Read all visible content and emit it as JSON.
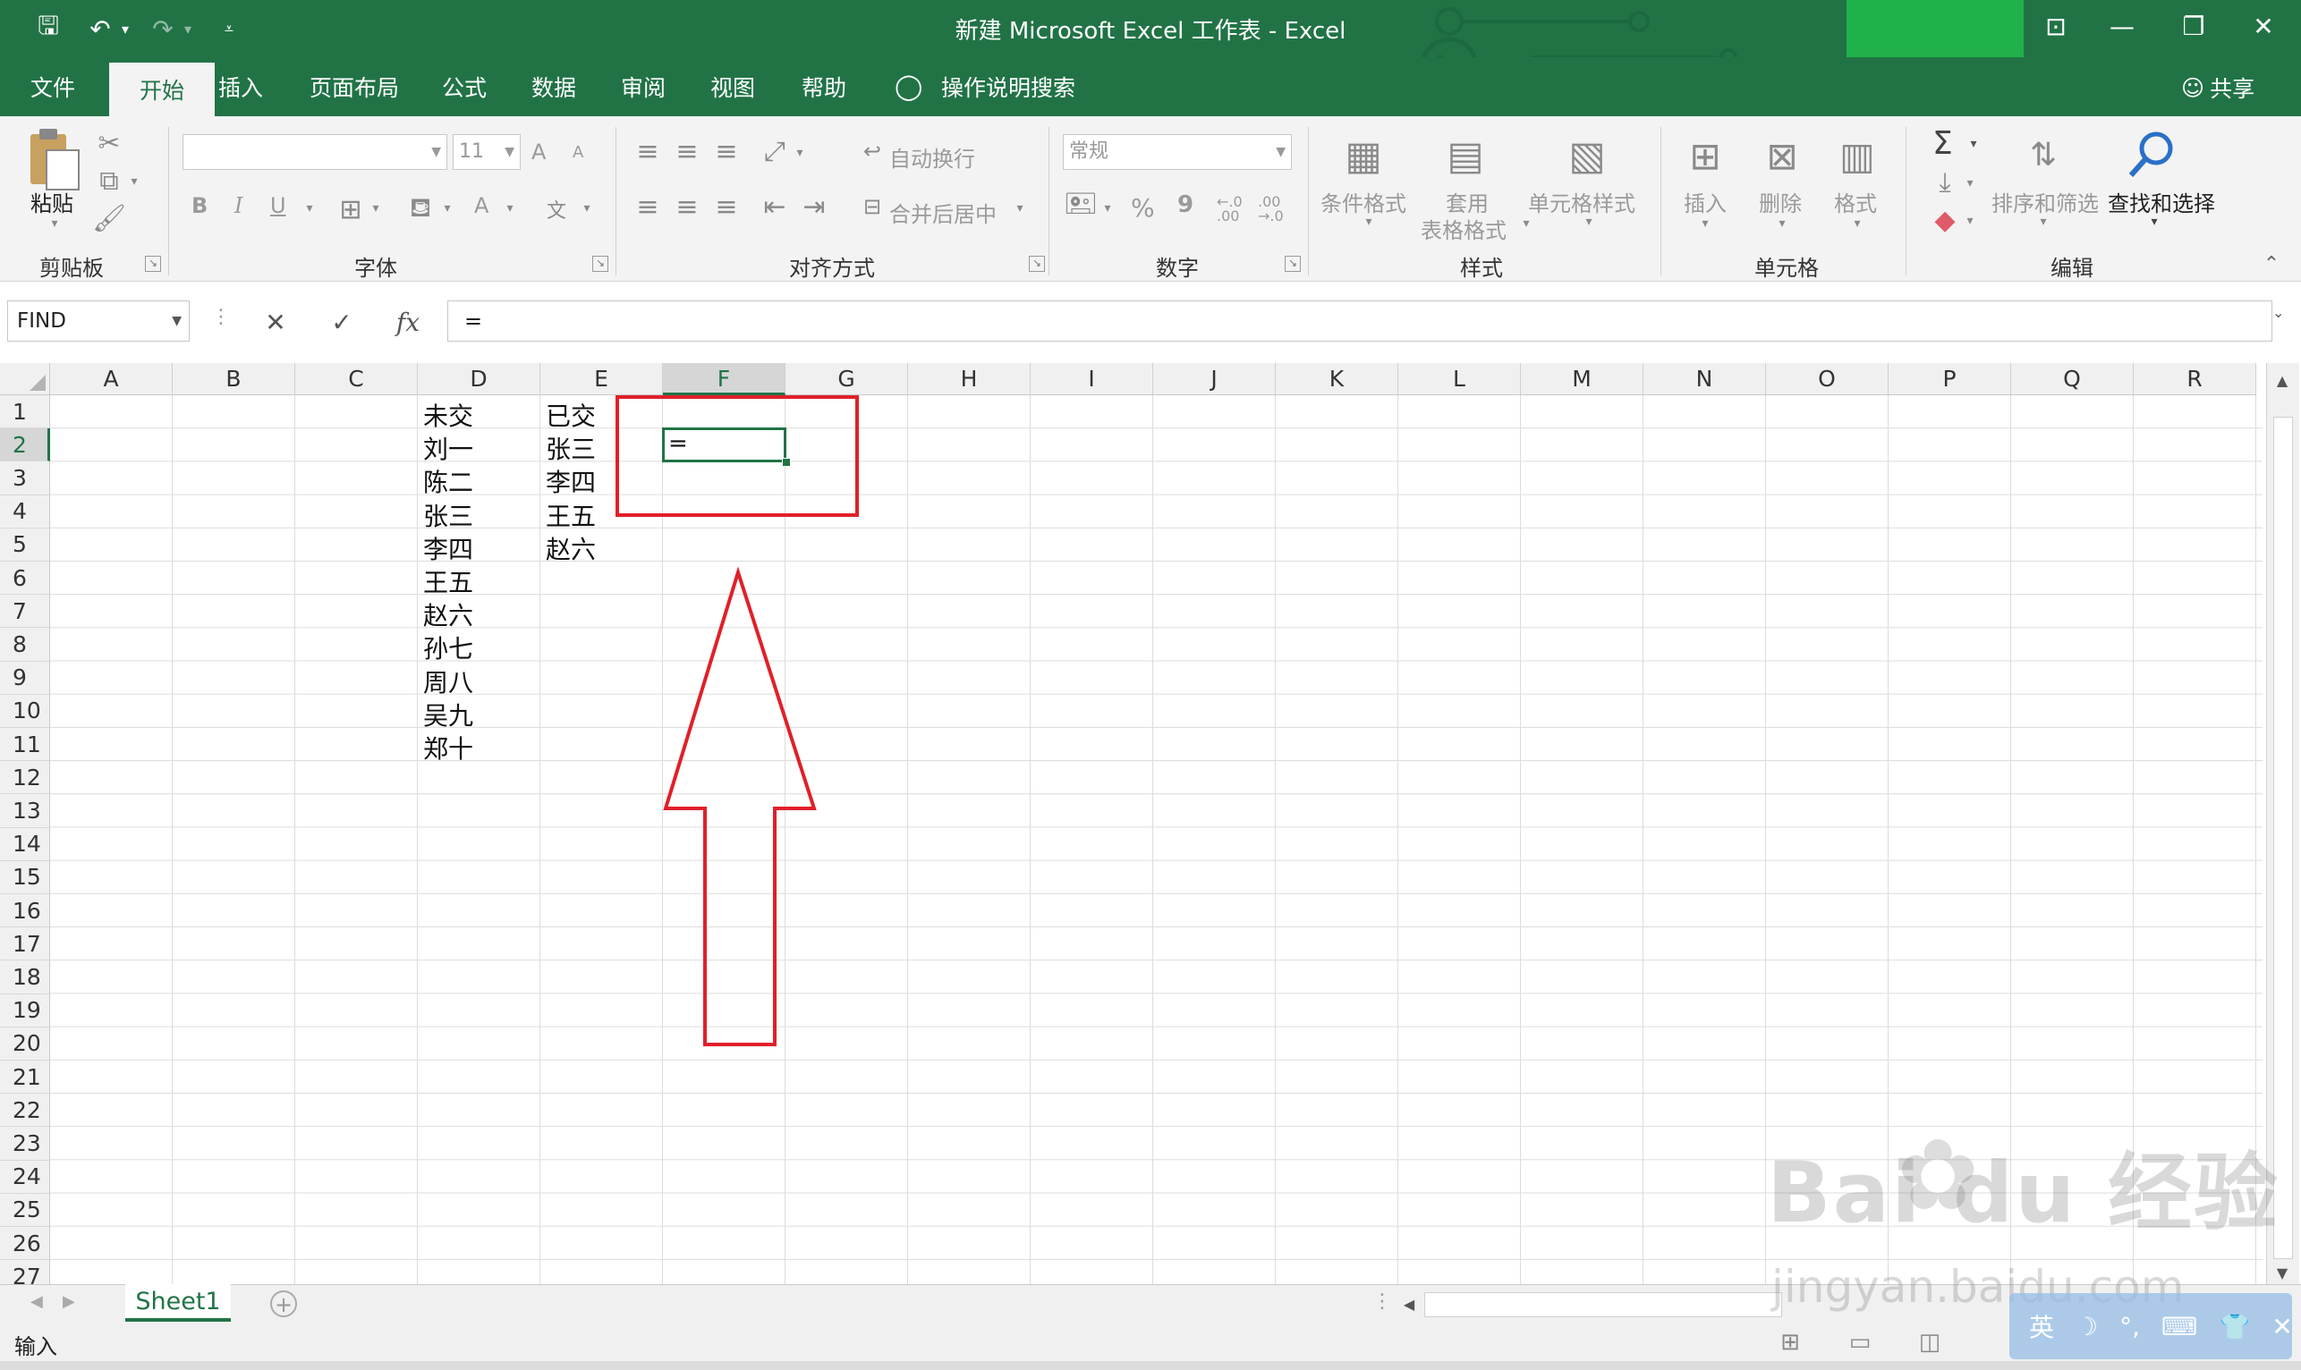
{
  "window": {
    "title": "新建 Microsoft Excel 工作表  -  Excel",
    "controls": {
      "ribbon_display": "⊡",
      "minimize": "—",
      "restore": "❐",
      "close": "✕"
    }
  },
  "qat": {
    "save": "🖫",
    "undo": "↶",
    "undo_dropdown": "▾",
    "redo": "↷",
    "redo_dropdown": "▾",
    "customize": "⩡"
  },
  "tabs": [
    {
      "label": "文件"
    },
    {
      "label": "开始"
    },
    {
      "label": "插入"
    },
    {
      "label": "页面布局"
    },
    {
      "label": "公式"
    },
    {
      "label": "数据"
    },
    {
      "label": "审阅"
    },
    {
      "label": "视图"
    },
    {
      "label": "帮助"
    }
  ],
  "tellme": "操作说明搜索",
  "share": "共享",
  "ribbon": {
    "clipboard": {
      "label": "剪贴板",
      "paste": "粘贴"
    },
    "font": {
      "label": "字体",
      "font_name": "",
      "font_size": "11",
      "bold": "B",
      "italic": "I",
      "underline": "U",
      "font_color": "A",
      "grow": "A",
      "shrink": "A"
    },
    "alignment": {
      "label": "对齐方式",
      "wrap": "自动换行",
      "merge": "合并后居中"
    },
    "number": {
      "label": "数字",
      "format": "常规",
      "percent": "%",
      "comma": "9",
      "inc_dec": "←.0 .00",
      "dec_dec": ".00 →.0"
    },
    "styles": {
      "label": "样式",
      "conditional": "条件格式",
      "table_l1": "套用",
      "table_l2": "表格格式",
      "cell_styles": "单元格样式"
    },
    "cells": {
      "label": "单元格",
      "insert": "插入",
      "delete": "删除",
      "format": "格式"
    },
    "editing": {
      "label": "编辑",
      "sum": "Σ",
      "sort": "排序和筛选",
      "find": "查找和选择"
    }
  },
  "formula_bar": {
    "name_box": "FIND",
    "cancel": "✕",
    "enter": "✓",
    "fx": "fx",
    "formula": "="
  },
  "grid": {
    "columns": [
      "A",
      "B",
      "C",
      "D",
      "E",
      "F",
      "G",
      "H",
      "I",
      "J",
      "K",
      "L",
      "M",
      "N",
      "O",
      "P",
      "Q",
      "R"
    ],
    "rows": [
      "1",
      "2",
      "3",
      "4",
      "5",
      "6",
      "7",
      "8",
      "9",
      "10",
      "11",
      "12",
      "13",
      "14",
      "15",
      "16",
      "17",
      "18",
      "19",
      "20",
      "21",
      "22",
      "23",
      "24",
      "25",
      "26",
      "27"
    ],
    "col_d": [
      "未交",
      "刘一",
      "陈二",
      "张三",
      "李四",
      "王五",
      "赵六",
      "孙七",
      "周八",
      "吴九",
      "郑十"
    ],
    "col_e": [
      "已交",
      "张三",
      "李四",
      "王五",
      "赵六"
    ],
    "active_cell": {
      "ref": "F2",
      "value": "="
    }
  },
  "sheet_tabs": [
    {
      "label": "Sheet1"
    }
  ],
  "status": {
    "mode": "输入"
  },
  "ime": {
    "lang": "英"
  },
  "watermark": {
    "brand": "Bai du 经验",
    "url": "jingyan.baidu.com"
  },
  "colors": {
    "excel_green": "#217346",
    "annotation_red": "#e0202a"
  }
}
